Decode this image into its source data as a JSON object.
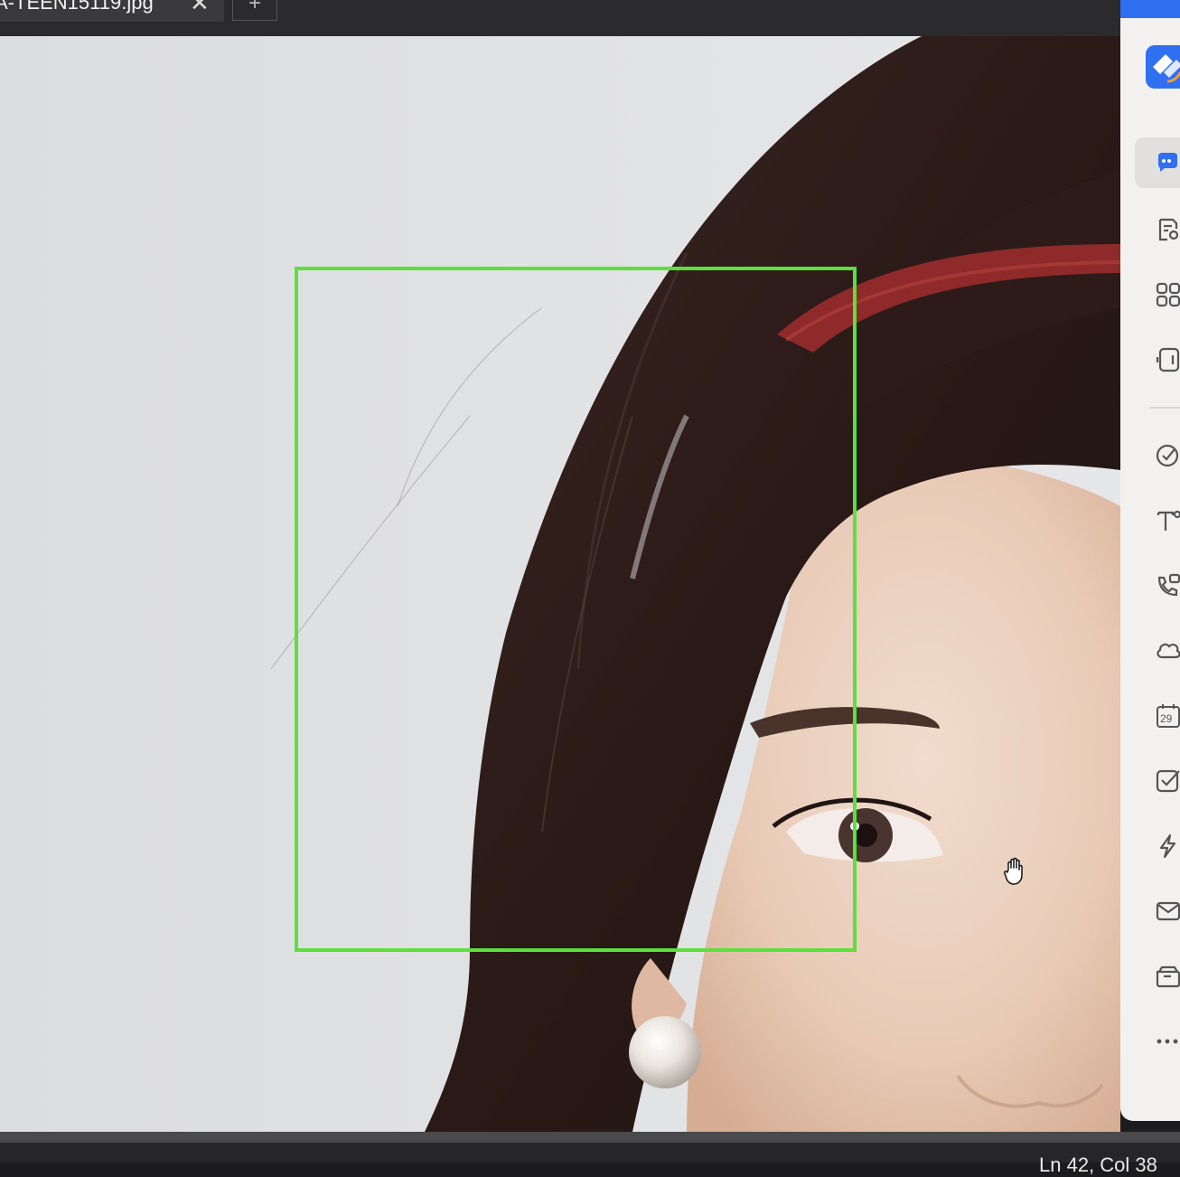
{
  "tabs": {
    "active_title": "A-TEEN15119.jpg",
    "close_glyph": "✕",
    "new_tab_glyph": "+"
  },
  "viewport": {
    "image_subject": "woman with dark hair, red headband and pearl earring",
    "selection_color": "#5be03d"
  },
  "side_panel": {
    "accent": "#2f6ff0",
    "items": [
      {
        "icon": "chat-bubbles-icon",
        "active": true
      },
      {
        "icon": "document-search-icon"
      },
      {
        "icon": "apps-grid-icon"
      },
      {
        "icon": "tablet-icon"
      },
      {
        "icon": "target-check-icon"
      },
      {
        "icon": "text-format-icon"
      },
      {
        "icon": "phone-calendar-icon"
      },
      {
        "icon": "cloud-icon"
      },
      {
        "icon": "calendar-icon",
        "label": "29"
      },
      {
        "icon": "checkbox-icon"
      },
      {
        "icon": "lightning-icon"
      },
      {
        "icon": "mail-icon"
      },
      {
        "icon": "folder-icon"
      },
      {
        "icon": "more-icon",
        "label": "..."
      }
    ]
  },
  "statusbar": {
    "cursor_position": "Ln 42, Col 38"
  }
}
